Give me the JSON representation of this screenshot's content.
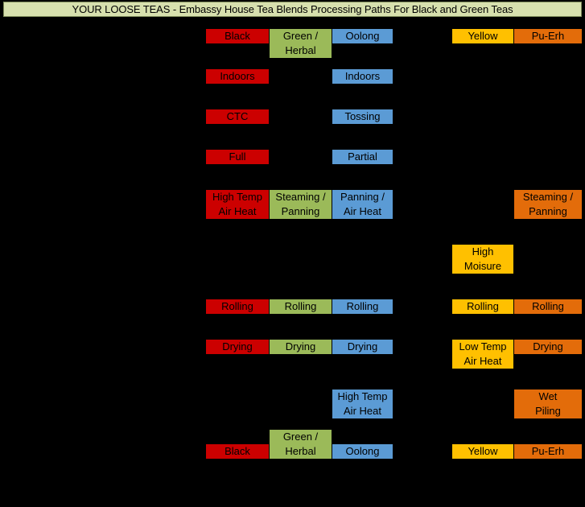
{
  "title": "YOUR LOOSE TEAS - Embassy House Tea Blends Processing Paths For Black and Green Teas",
  "colors": {
    "title_bar": "#D7E0AE",
    "black_tea": "#CC0000",
    "green_tea": "#9BBA59",
    "oolong_tea": "#5B9BD5",
    "yellow_tea": "#FFC000",
    "puerh_tea": "#E36C0A",
    "background": "#000000"
  },
  "columns": [
    {
      "key": "black",
      "label": "Black",
      "color": "#CC0000"
    },
    {
      "key": "green",
      "label": "Green / Herbal",
      "color": "#9BBA59"
    },
    {
      "key": "oolong",
      "label": "Oolong",
      "color": "#5B9BD5"
    },
    {
      "key": "yellow",
      "label": "Yellow",
      "color": "#FFC000"
    },
    {
      "key": "puerh",
      "label": "Pu-Erh",
      "color": "#E36C0A"
    }
  ],
  "rows": [
    {
      "name": "tea-types-top",
      "cells": {
        "black": [
          "Black"
        ],
        "green": [
          "Green /",
          "Herbal"
        ],
        "oolong": [
          "Oolong"
        ],
        "yellow": [
          "Yellow"
        ],
        "puerh": [
          "Pu-Erh"
        ]
      }
    },
    {
      "name": "withering",
      "cells": {
        "black": [
          "Indoors"
        ],
        "green": [],
        "oolong": [
          "Indoors"
        ],
        "yellow": [],
        "puerh": []
      }
    },
    {
      "name": "bruising",
      "cells": {
        "black": [
          "CTC"
        ],
        "green": [],
        "oolong": [
          "Tossing"
        ],
        "yellow": [],
        "puerh": []
      }
    },
    {
      "name": "oxidation",
      "cells": {
        "black": [
          "Full"
        ],
        "green": [],
        "oolong": [
          "Partial"
        ],
        "yellow": [],
        "puerh": []
      }
    },
    {
      "name": "fixation-heat",
      "cells": {
        "black": [
          "High Temp",
          "Air Heat"
        ],
        "green": [
          "Steaming /",
          "Panning"
        ],
        "oolong": [
          "Panning /",
          "Air Heat"
        ],
        "yellow": [],
        "puerh": [
          "Steaming /",
          "Panning"
        ]
      }
    },
    {
      "name": "yellowing",
      "cells": {
        "black": [],
        "green": [],
        "oolong": [],
        "yellow": [
          "High",
          "Moisure"
        ],
        "puerh": []
      }
    },
    {
      "name": "rolling",
      "cells": {
        "black": [
          "Rolling"
        ],
        "green": [
          "Rolling"
        ],
        "oolong": [
          "Rolling"
        ],
        "yellow": [
          "Rolling"
        ],
        "puerh": [
          "Rolling"
        ]
      }
    },
    {
      "name": "drying",
      "cells": {
        "black": [
          "Drying"
        ],
        "green": [
          "Drying"
        ],
        "oolong": [
          "Drying"
        ],
        "yellow": [
          "Low Temp",
          "Air Heat"
        ],
        "puerh": [
          "Drying"
        ]
      }
    },
    {
      "name": "firing-piling",
      "cells": {
        "black": [],
        "green": [],
        "oolong": [
          "High Temp",
          "Air Heat"
        ],
        "yellow": [],
        "puerh": [
          "Wet",
          "Piling"
        ]
      }
    },
    {
      "name": "tea-types-bottom",
      "cells": {
        "black": [
          "Black"
        ],
        "green": [
          "Green /",
          "Herbal"
        ],
        "oolong": [
          "Oolong"
        ],
        "yellow": [
          "Yellow"
        ],
        "puerh": [
          "Pu-Erh"
        ]
      },
      "bottom_aligned": true
    }
  ]
}
